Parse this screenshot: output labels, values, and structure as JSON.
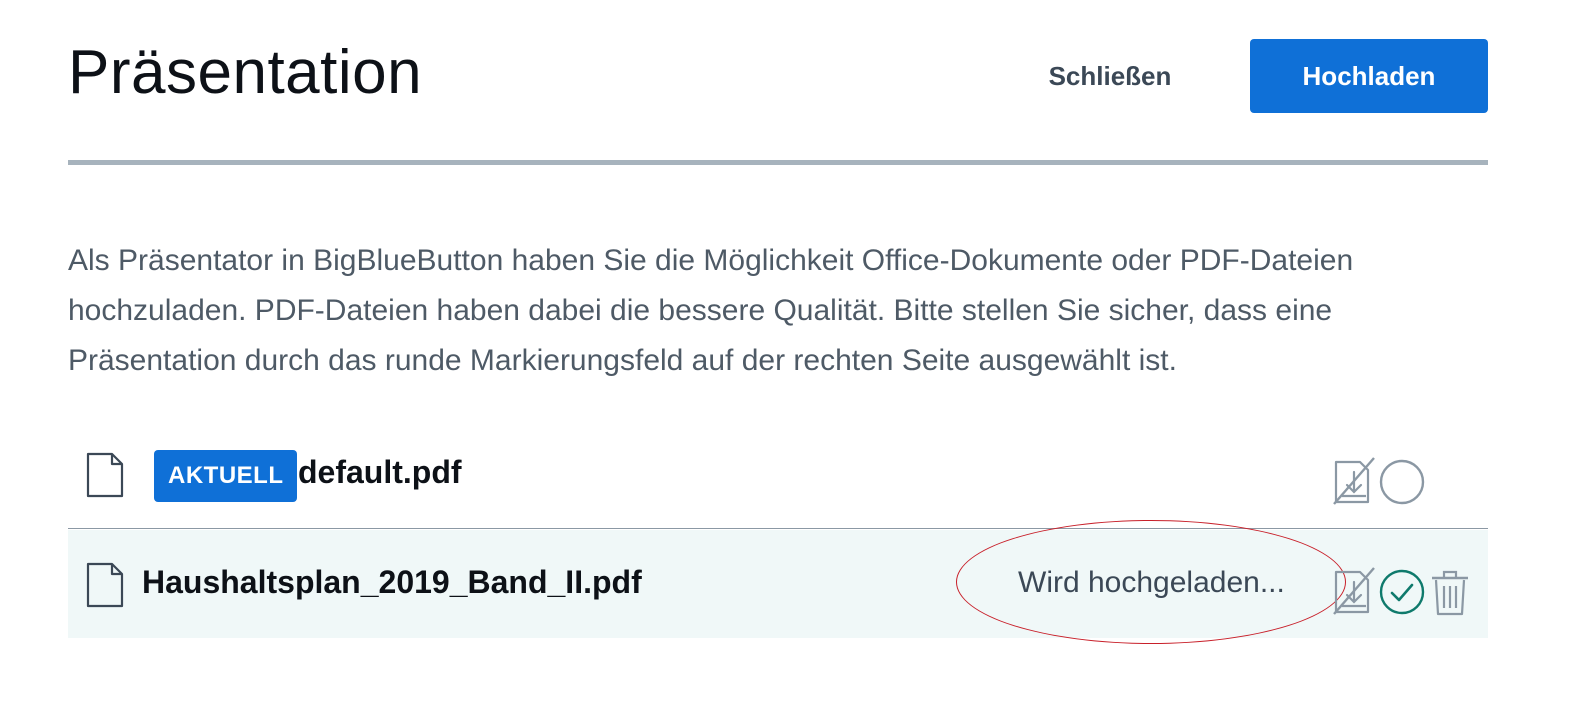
{
  "header": {
    "title": "Präsentation",
    "close_label": "Schließen",
    "upload_label": "Hochladen"
  },
  "description": "Als Präsentator in BigBlueButton haben Sie die Möglichkeit Office-Dokumente oder PDF-Dateien hochzuladen. PDF-Dateien haben dabei die bessere Qualität. Bitte stellen Sie sicher, dass eine Präsentation durch das runde Markierungsfeld auf der rechten Seite ausgewählt ist.",
  "files": [
    {
      "badge": "AKTUELL",
      "name": "default.pdf",
      "status": "",
      "icons": [
        "file-icon",
        "download-disabled-icon",
        "select-circle-icon"
      ]
    },
    {
      "badge": "",
      "name": "Haushaltsplan_2019_Band_II.pdf",
      "status": "Wird hochgeladen...",
      "icons": [
        "file-icon",
        "download-disabled-icon",
        "check-circle-icon",
        "trash-icon"
      ]
    }
  ],
  "colors": {
    "primary": "#0f70d7",
    "divider": "#a7b3bd",
    "row_highlight": "#f0f8f8",
    "check_green": "#0f7a6c",
    "annotation_red": "#c8202a"
  }
}
